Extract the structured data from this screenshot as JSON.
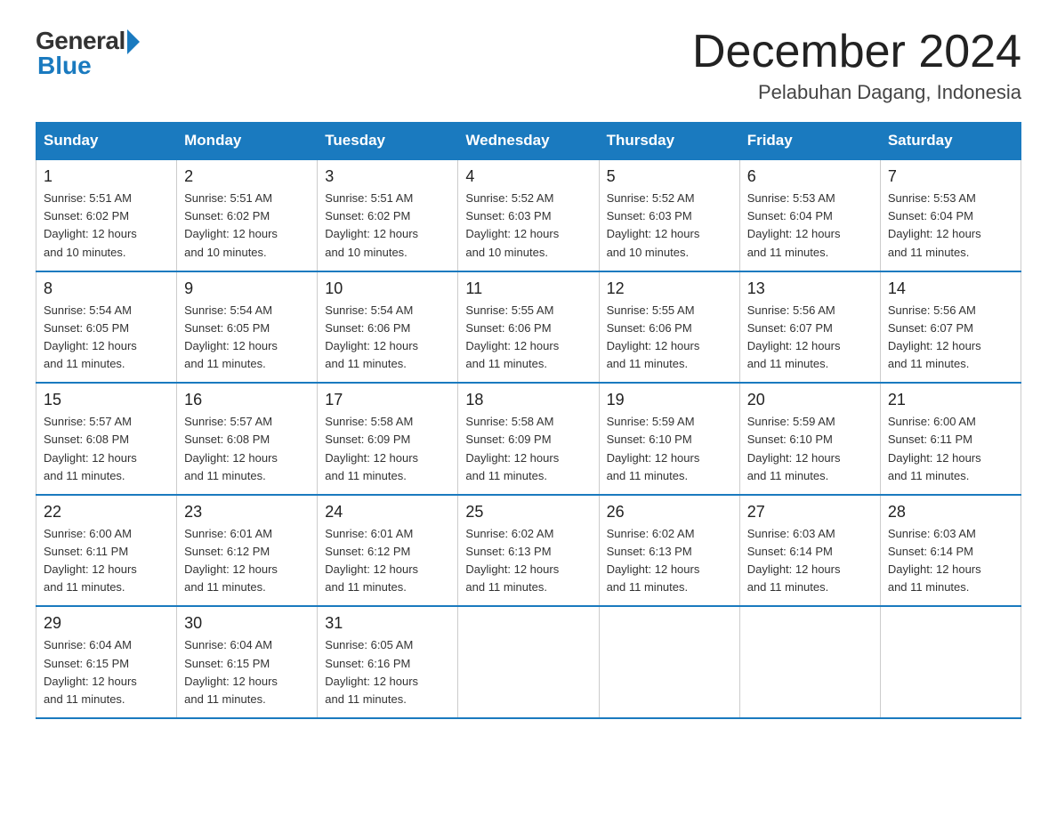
{
  "logo": {
    "general": "General",
    "blue": "Blue"
  },
  "header": {
    "month": "December 2024",
    "location": "Pelabuhan Dagang, Indonesia"
  },
  "days_of_week": [
    "Sunday",
    "Monday",
    "Tuesday",
    "Wednesday",
    "Thursday",
    "Friday",
    "Saturday"
  ],
  "weeks": [
    [
      {
        "day": "1",
        "sunrise": "5:51 AM",
        "sunset": "6:02 PM",
        "daylight": "12 hours and 10 minutes."
      },
      {
        "day": "2",
        "sunrise": "5:51 AM",
        "sunset": "6:02 PM",
        "daylight": "12 hours and 10 minutes."
      },
      {
        "day": "3",
        "sunrise": "5:51 AM",
        "sunset": "6:02 PM",
        "daylight": "12 hours and 10 minutes."
      },
      {
        "day": "4",
        "sunrise": "5:52 AM",
        "sunset": "6:03 PM",
        "daylight": "12 hours and 10 minutes."
      },
      {
        "day": "5",
        "sunrise": "5:52 AM",
        "sunset": "6:03 PM",
        "daylight": "12 hours and 10 minutes."
      },
      {
        "day": "6",
        "sunrise": "5:53 AM",
        "sunset": "6:04 PM",
        "daylight": "12 hours and 11 minutes."
      },
      {
        "day": "7",
        "sunrise": "5:53 AM",
        "sunset": "6:04 PM",
        "daylight": "12 hours and 11 minutes."
      }
    ],
    [
      {
        "day": "8",
        "sunrise": "5:54 AM",
        "sunset": "6:05 PM",
        "daylight": "12 hours and 11 minutes."
      },
      {
        "day": "9",
        "sunrise": "5:54 AM",
        "sunset": "6:05 PM",
        "daylight": "12 hours and 11 minutes."
      },
      {
        "day": "10",
        "sunrise": "5:54 AM",
        "sunset": "6:06 PM",
        "daylight": "12 hours and 11 minutes."
      },
      {
        "day": "11",
        "sunrise": "5:55 AM",
        "sunset": "6:06 PM",
        "daylight": "12 hours and 11 minutes."
      },
      {
        "day": "12",
        "sunrise": "5:55 AM",
        "sunset": "6:06 PM",
        "daylight": "12 hours and 11 minutes."
      },
      {
        "day": "13",
        "sunrise": "5:56 AM",
        "sunset": "6:07 PM",
        "daylight": "12 hours and 11 minutes."
      },
      {
        "day": "14",
        "sunrise": "5:56 AM",
        "sunset": "6:07 PM",
        "daylight": "12 hours and 11 minutes."
      }
    ],
    [
      {
        "day": "15",
        "sunrise": "5:57 AM",
        "sunset": "6:08 PM",
        "daylight": "12 hours and 11 minutes."
      },
      {
        "day": "16",
        "sunrise": "5:57 AM",
        "sunset": "6:08 PM",
        "daylight": "12 hours and 11 minutes."
      },
      {
        "day": "17",
        "sunrise": "5:58 AM",
        "sunset": "6:09 PM",
        "daylight": "12 hours and 11 minutes."
      },
      {
        "day": "18",
        "sunrise": "5:58 AM",
        "sunset": "6:09 PM",
        "daylight": "12 hours and 11 minutes."
      },
      {
        "day": "19",
        "sunrise": "5:59 AM",
        "sunset": "6:10 PM",
        "daylight": "12 hours and 11 minutes."
      },
      {
        "day": "20",
        "sunrise": "5:59 AM",
        "sunset": "6:10 PM",
        "daylight": "12 hours and 11 minutes."
      },
      {
        "day": "21",
        "sunrise": "6:00 AM",
        "sunset": "6:11 PM",
        "daylight": "12 hours and 11 minutes."
      }
    ],
    [
      {
        "day": "22",
        "sunrise": "6:00 AM",
        "sunset": "6:11 PM",
        "daylight": "12 hours and 11 minutes."
      },
      {
        "day": "23",
        "sunrise": "6:01 AM",
        "sunset": "6:12 PM",
        "daylight": "12 hours and 11 minutes."
      },
      {
        "day": "24",
        "sunrise": "6:01 AM",
        "sunset": "6:12 PM",
        "daylight": "12 hours and 11 minutes."
      },
      {
        "day": "25",
        "sunrise": "6:02 AM",
        "sunset": "6:13 PM",
        "daylight": "12 hours and 11 minutes."
      },
      {
        "day": "26",
        "sunrise": "6:02 AM",
        "sunset": "6:13 PM",
        "daylight": "12 hours and 11 minutes."
      },
      {
        "day": "27",
        "sunrise": "6:03 AM",
        "sunset": "6:14 PM",
        "daylight": "12 hours and 11 minutes."
      },
      {
        "day": "28",
        "sunrise": "6:03 AM",
        "sunset": "6:14 PM",
        "daylight": "12 hours and 11 minutes."
      }
    ],
    [
      {
        "day": "29",
        "sunrise": "6:04 AM",
        "sunset": "6:15 PM",
        "daylight": "12 hours and 11 minutes."
      },
      {
        "day": "30",
        "sunrise": "6:04 AM",
        "sunset": "6:15 PM",
        "daylight": "12 hours and 11 minutes."
      },
      {
        "day": "31",
        "sunrise": "6:05 AM",
        "sunset": "6:16 PM",
        "daylight": "12 hours and 11 minutes."
      },
      null,
      null,
      null,
      null
    ]
  ],
  "labels": {
    "sunrise": "Sunrise:",
    "sunset": "Sunset:",
    "daylight": "Daylight:"
  }
}
